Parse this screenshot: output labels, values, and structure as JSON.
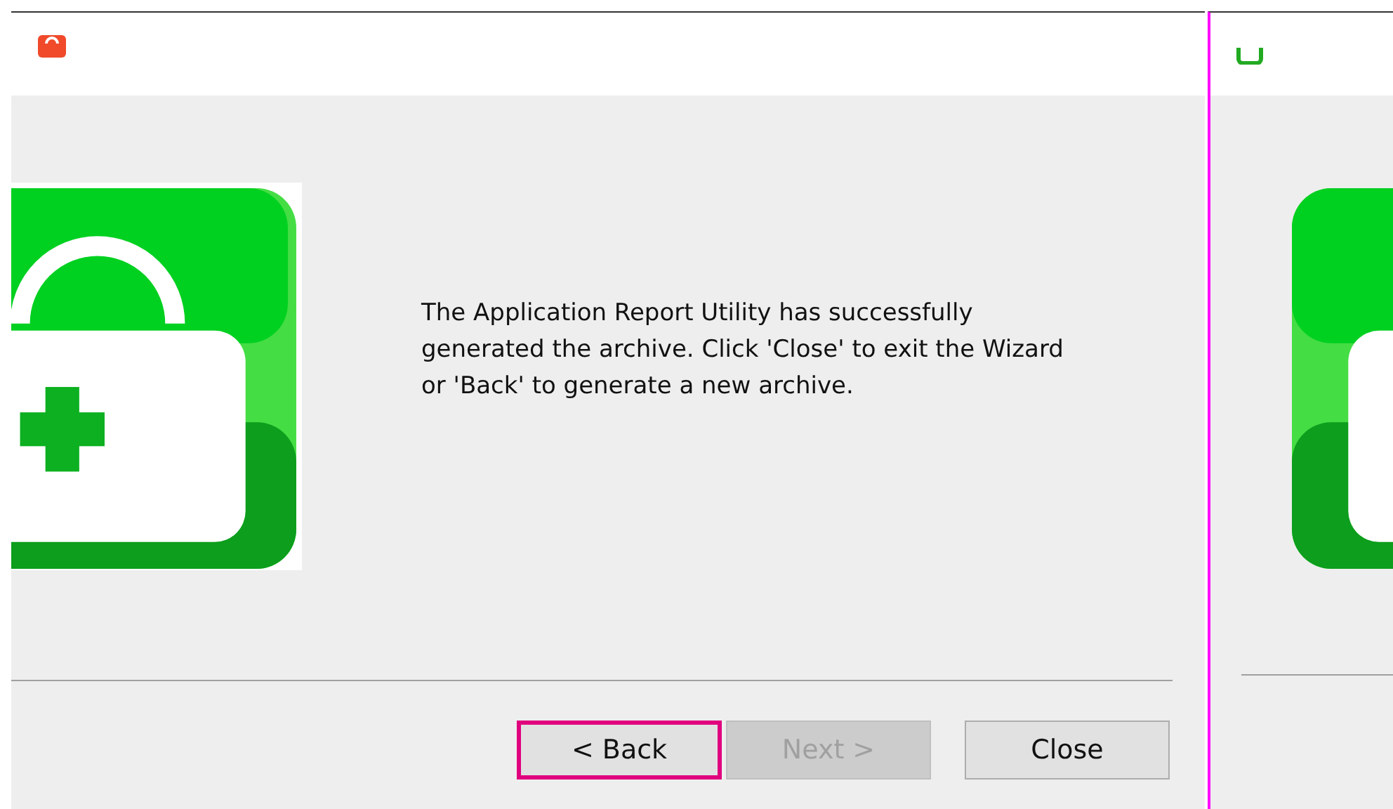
{
  "wizard": {
    "message": "The Application Report Utility has successfully generated the archive. Click 'Close' to exit the Wizard or 'Back' to generate a new archive."
  },
  "buttons": [
    {
      "label": "< Back",
      "disabled": false,
      "focused": true
    },
    {
      "label": "Next >",
      "disabled": true,
      "focused": false
    },
    {
      "label": "Close",
      "disabled": false,
      "focused": false
    }
  ]
}
